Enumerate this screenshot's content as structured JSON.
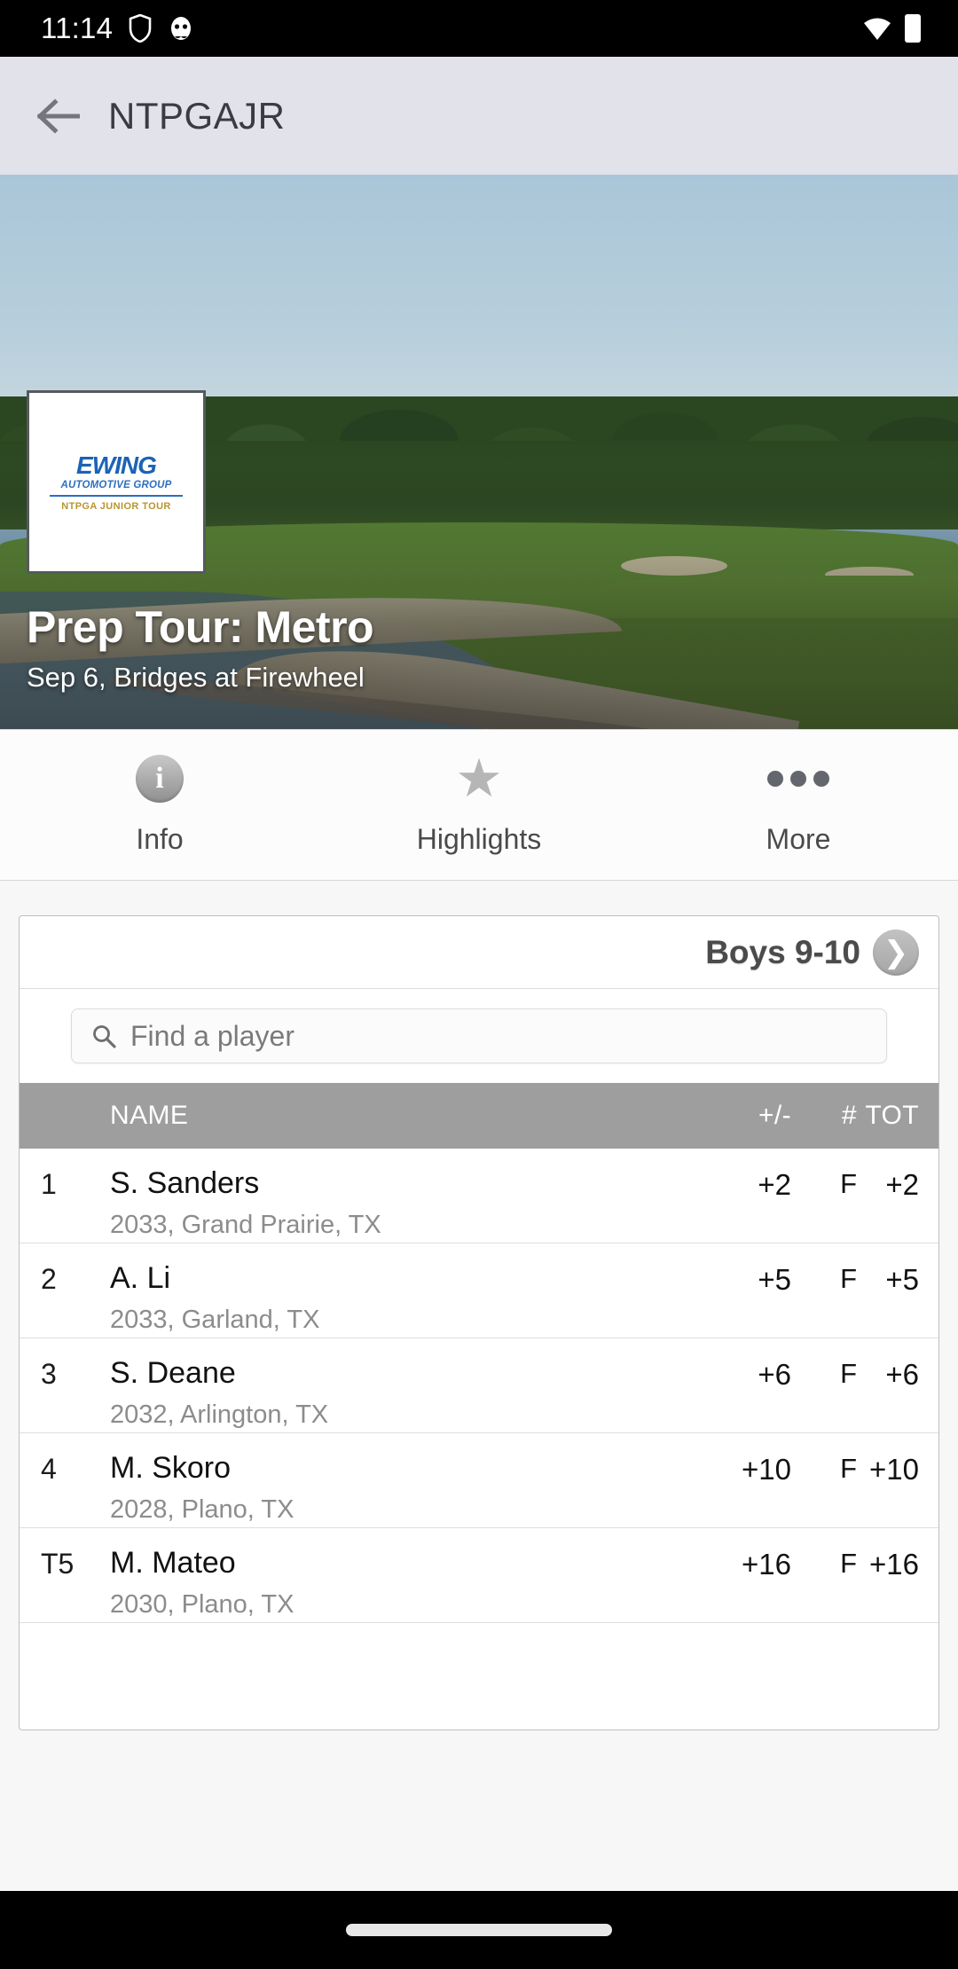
{
  "status_bar": {
    "time": "11:14",
    "icons": [
      "shield-icon",
      "ghost-icon"
    ],
    "right_icons": [
      "wifi-icon",
      "battery-icon"
    ]
  },
  "app_bar": {
    "back_icon": "back-arrow-icon",
    "title": "NTPGAJR"
  },
  "hero": {
    "logo": {
      "brand": "EWING",
      "brand_sub": "AUTOMOTIVE GROUP",
      "tour": "NTPGA JUNIOR TOUR",
      "brand_color": "#1b63b5",
      "tour_color": "#b9952f"
    },
    "title": "Prep Tour: Metro",
    "subtitle": "Sep 6, Bridges at Firewheel"
  },
  "tabs": [
    {
      "label": "Info",
      "icon": "info-circle-icon"
    },
    {
      "label": "Highlights",
      "icon": "star-icon"
    },
    {
      "label": "More",
      "icon": "ellipsis-icon"
    }
  ],
  "leaderboard": {
    "division": "Boys 9-10",
    "next_icon": "chevron-right-icon",
    "search": {
      "placeholder": "Find a player",
      "value": "",
      "icon": "search-icon"
    },
    "columns": {
      "rank": "",
      "name": "NAME",
      "plus_minus": "+/-",
      "thru": "#",
      "total": "TOT"
    },
    "rows": [
      {
        "rank": "1",
        "name": "S. Sanders",
        "meta": "2033, Grand Prairie, TX",
        "plus_minus": "+2",
        "thru": "F",
        "total": "+2"
      },
      {
        "rank": "2",
        "name": "A. Li",
        "meta": "2033, Garland, TX",
        "plus_minus": "+5",
        "thru": "F",
        "total": "+5"
      },
      {
        "rank": "3",
        "name": "S. Deane",
        "meta": "2032, Arlington, TX",
        "plus_minus": "+6",
        "thru": "F",
        "total": "+6"
      },
      {
        "rank": "4",
        "name": "M. Skoro",
        "meta": "2028, Plano, TX",
        "plus_minus": "+10",
        "thru": "F",
        "total": "+10"
      },
      {
        "rank": "T5",
        "name": "M. Mateo",
        "meta": "2030, Plano, TX",
        "plus_minus": "+16",
        "thru": "F",
        "total": "+16"
      }
    ]
  },
  "nav_bar": {
    "home_indicator": "home-indicator"
  }
}
